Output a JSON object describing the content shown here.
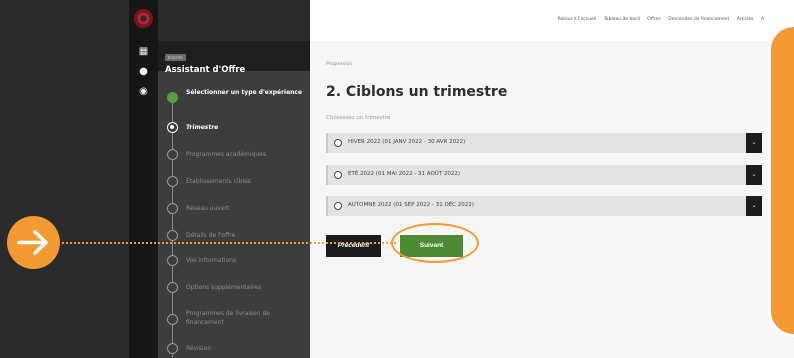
{
  "topnav": {
    "links": [
      "Retour à l'accueil",
      "Tableau de bord",
      "Offres",
      "Demandes de financement",
      "Articles",
      "A"
    ]
  },
  "sidebar": {
    "tag": "Inscrire",
    "title": "Assistant d'Offre",
    "steps": [
      {
        "label": "Sélectionner un type d'expérience",
        "state": "done"
      },
      {
        "label": "Trimestre",
        "state": "active"
      },
      {
        "label": "Programmes académiques",
        "state": "pending"
      },
      {
        "label": "Établissements ciblés",
        "state": "pending"
      },
      {
        "label": "Réseau ouvert",
        "state": "pending"
      },
      {
        "label": "Détails de l'offre",
        "state": "pending"
      },
      {
        "label": "Vos informations",
        "state": "pending"
      },
      {
        "label": "Options supplémentaires",
        "state": "pending"
      },
      {
        "label": "Programmes de livraison de financement",
        "state": "pending"
      },
      {
        "label": "Révision",
        "state": "pending"
      }
    ]
  },
  "main": {
    "breadcrumb": "Progression",
    "heading": "2. Ciblons un trimestre",
    "subheading": "Choisissez un trimestre",
    "options": [
      {
        "label": "HIVER 2022 (01 JANV 2022 - 30 AVR 2022)"
      },
      {
        "label": "ÉTÉ 2022 (01 MAI 2022 - 31 AOÛT 2022)"
      },
      {
        "label": "AUTOMNE 2022 (01 SEP 2022 - 31 DÉC 2022)"
      }
    ],
    "prev_label": "Précédent",
    "next_label": "Suivant"
  },
  "colors": {
    "accent_orange": "#f39a32",
    "next_green": "#4e8a33",
    "step_done_green": "#56a13f",
    "logo_red": "#b3262d"
  },
  "icons": {
    "rail": [
      "logo-icon",
      "grid-icon",
      "bell-icon",
      "user-icon"
    ],
    "overlay": "arrow-right-icon",
    "option_toggle": "chevron-down-icon"
  }
}
